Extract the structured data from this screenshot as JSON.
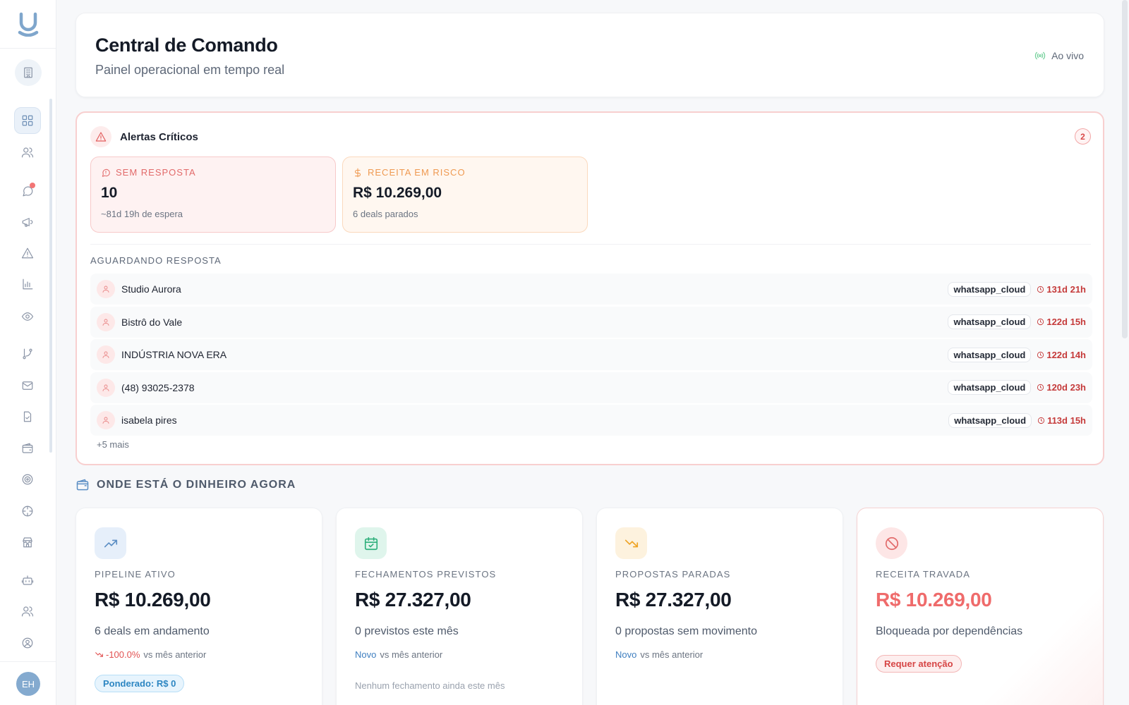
{
  "sidebar": {
    "user_initials": "EH",
    "icons": [
      "logo-icon",
      "building-icon",
      "dashboard-icon",
      "users-icon",
      "chat-icon",
      "megaphone-icon",
      "alert-triangle-icon",
      "bar-chart-icon",
      "eye-icon",
      "git-branch-icon",
      "mail-icon",
      "file-check-icon",
      "wallet-icon",
      "target-icon",
      "crosshair-icon",
      "store-icon",
      "bot-icon",
      "team-icon",
      "user-circle-icon"
    ]
  },
  "header": {
    "title": "Central de Comando",
    "subtitle": "Painel operacional em tempo real",
    "live_label": "Ao vivo"
  },
  "alerts": {
    "title": "Alertas Críticos",
    "count": "2",
    "no_response": {
      "label": "SEM RESPOSTA",
      "value": "10",
      "sub": "~81d 19h de espera"
    },
    "revenue_risk": {
      "label": "RECEITA EM RISCO",
      "value": "R$ 10.269,00",
      "sub": "6 deals parados"
    },
    "waiting_label": "AGUARDANDO RESPOSTA",
    "waiting": [
      {
        "name": "Studio Aurora",
        "channel": "whatsapp_cloud",
        "time": "131d 21h"
      },
      {
        "name": "Bistrô do Vale",
        "channel": "whatsapp_cloud",
        "time": "122d 15h"
      },
      {
        "name": "INDÚSTRIA NOVA ERA",
        "channel": "whatsapp_cloud",
        "time": "122d 14h"
      },
      {
        "name": "(48) 93025-2378",
        "channel": "whatsapp_cloud",
        "time": "120d 23h"
      },
      {
        "name": "isabela pires",
        "channel": "whatsapp_cloud",
        "time": "113d 15h"
      }
    ],
    "more": "+5 mais"
  },
  "money": {
    "title": "ONDE ESTÁ O DINHEIRO AGORA",
    "cards": [
      {
        "label": "PIPELINE ATIVO",
        "value": "R$ 10.269,00",
        "sub": "6 deals em andamento",
        "trend_value": "-100.0%",
        "trend_text": "vs mês anterior",
        "chip": "Ponderado: R$ 0"
      },
      {
        "label": "FECHAMENTOS PREVISTOS",
        "value": "R$ 27.327,00",
        "sub": "0 previstos este mês",
        "trend_value": "Novo",
        "trend_text": "vs mês anterior",
        "note": "Nenhum fechamento ainda este mês"
      },
      {
        "label": "PROPOSTAS PARADAS",
        "value": "R$ 27.327,00",
        "sub": "0 propostas sem movimento",
        "trend_value": "Novo",
        "trend_text": "vs mês anterior"
      },
      {
        "label": "RECEITA TRAVADA",
        "value": "R$ 10.269,00",
        "sub": "Bloqueada por dependências",
        "chip": "Requer atenção"
      }
    ]
  }
}
